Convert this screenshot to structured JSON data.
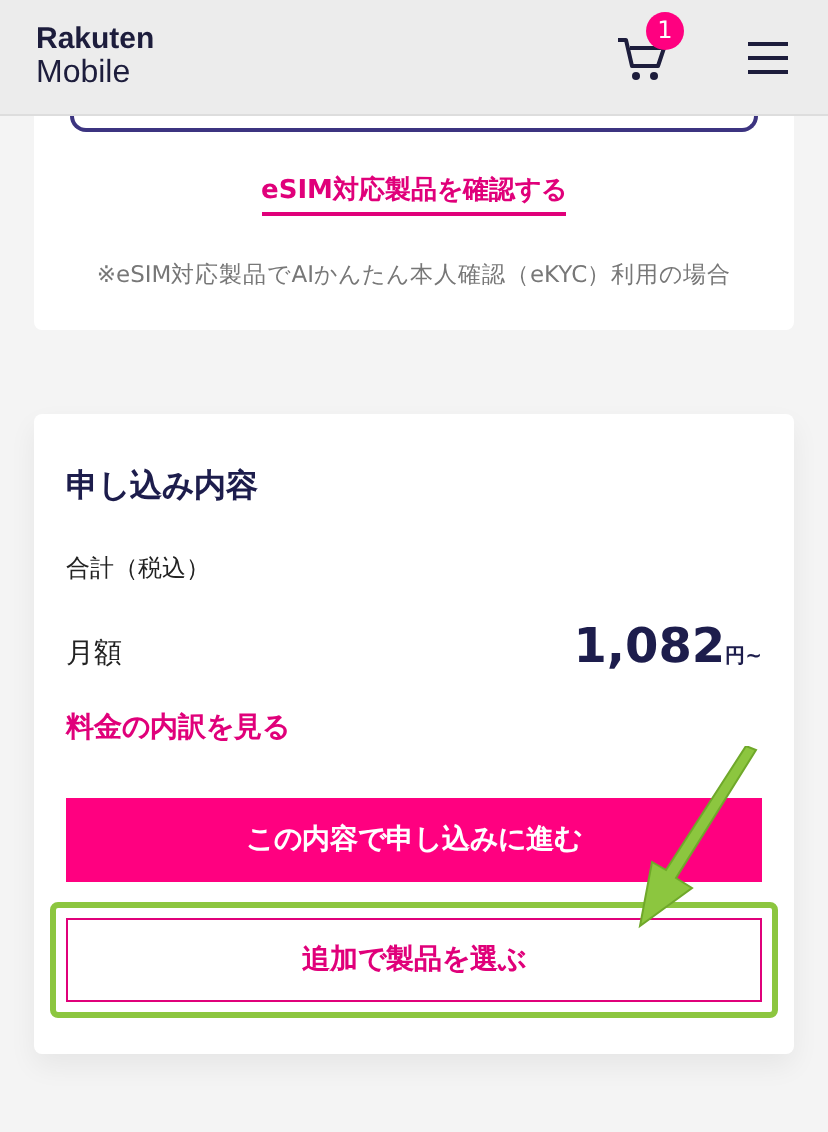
{
  "header": {
    "logo_top": "Rakuten",
    "logo_bottom": "Mobile",
    "cart_count": "1"
  },
  "esim_card": {
    "link": "eSIM対応製品を確認する",
    "note": "※eSIM対応製品でAIかんたん本人確認（eKYC）利用の場合"
  },
  "summary": {
    "title": "申し込み内容",
    "total_label": "合計（税込）",
    "monthly_label": "月額",
    "price": "1,082",
    "price_unit": "円~",
    "breakdown_link": "料金の内訳を見る",
    "buttons": [
      {
        "label": "この内容で申し込みに進む",
        "kind": "primary",
        "highlighted": false
      },
      {
        "label": "追加で製品を選ぶ",
        "kind": "secondary",
        "highlighted": true
      }
    ]
  }
}
